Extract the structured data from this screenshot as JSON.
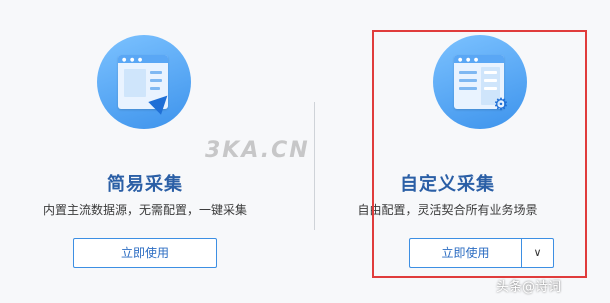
{
  "left_card": {
    "title": "简易采集",
    "description": "内置主流数据源，无需配置，一键采集",
    "button_label": "立即使用",
    "icon": "document-send-icon"
  },
  "right_card": {
    "title": "自定义采集",
    "description": "自由配置，灵活契合所有业务场景",
    "button_label": "立即使用",
    "dropdown_glyph": "∨",
    "icon": "document-settings-icon"
  },
  "watermark": "3KA.CN",
  "corner_watermark": "头条@诗词",
  "colors": {
    "accent": "#3d93ec",
    "title": "#2b5fa6",
    "highlight": "#e03c3c"
  }
}
